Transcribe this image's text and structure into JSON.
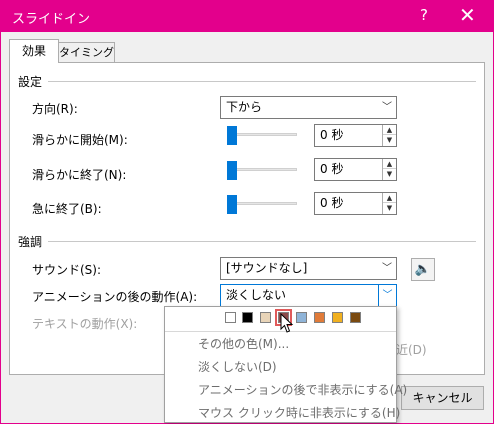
{
  "window": {
    "title": "スライドイン",
    "help": "?",
    "close": "✕",
    "accent_color": "#e3008c"
  },
  "tabs": [
    {
      "label": "効果"
    },
    {
      "label": "タイミング"
    }
  ],
  "settings": {
    "heading": "設定",
    "direction_label": "方向(R):",
    "direction_value": "下から",
    "smooth_start_label": "滑らかに開始(M):",
    "smooth_start_value": "0 秒",
    "smooth_end_label": "滑らかに終了(N):",
    "smooth_end_value": "0 秒",
    "sudden_end_label": "急に終了(B):",
    "sudden_end_value": "0 秒"
  },
  "emphasis": {
    "heading": "強調",
    "sound_label": "サウンド(S):",
    "sound_value": "[サウンドなし]",
    "after_anim_label": "アニメーションの後の動作(A):",
    "after_anim_value": "淡くしない",
    "text_anim_label": "テキストの動作(X):",
    "partial_text": "近(D)"
  },
  "dropdown": {
    "swatch_colors": [
      "#ffffff",
      "#000000",
      "#e8d4b8",
      "#8b4a4a",
      "#8fb4d8",
      "#e07b39",
      "#f0b020",
      "#7a4a10"
    ],
    "items": [
      "その他の色(M)...",
      "淡くしない(D)",
      "アニメーションの後で非表示にする(A)",
      "マウス クリック時に非表示にする(H)"
    ]
  },
  "footer": {
    "cancel_label": "キャンセル"
  }
}
